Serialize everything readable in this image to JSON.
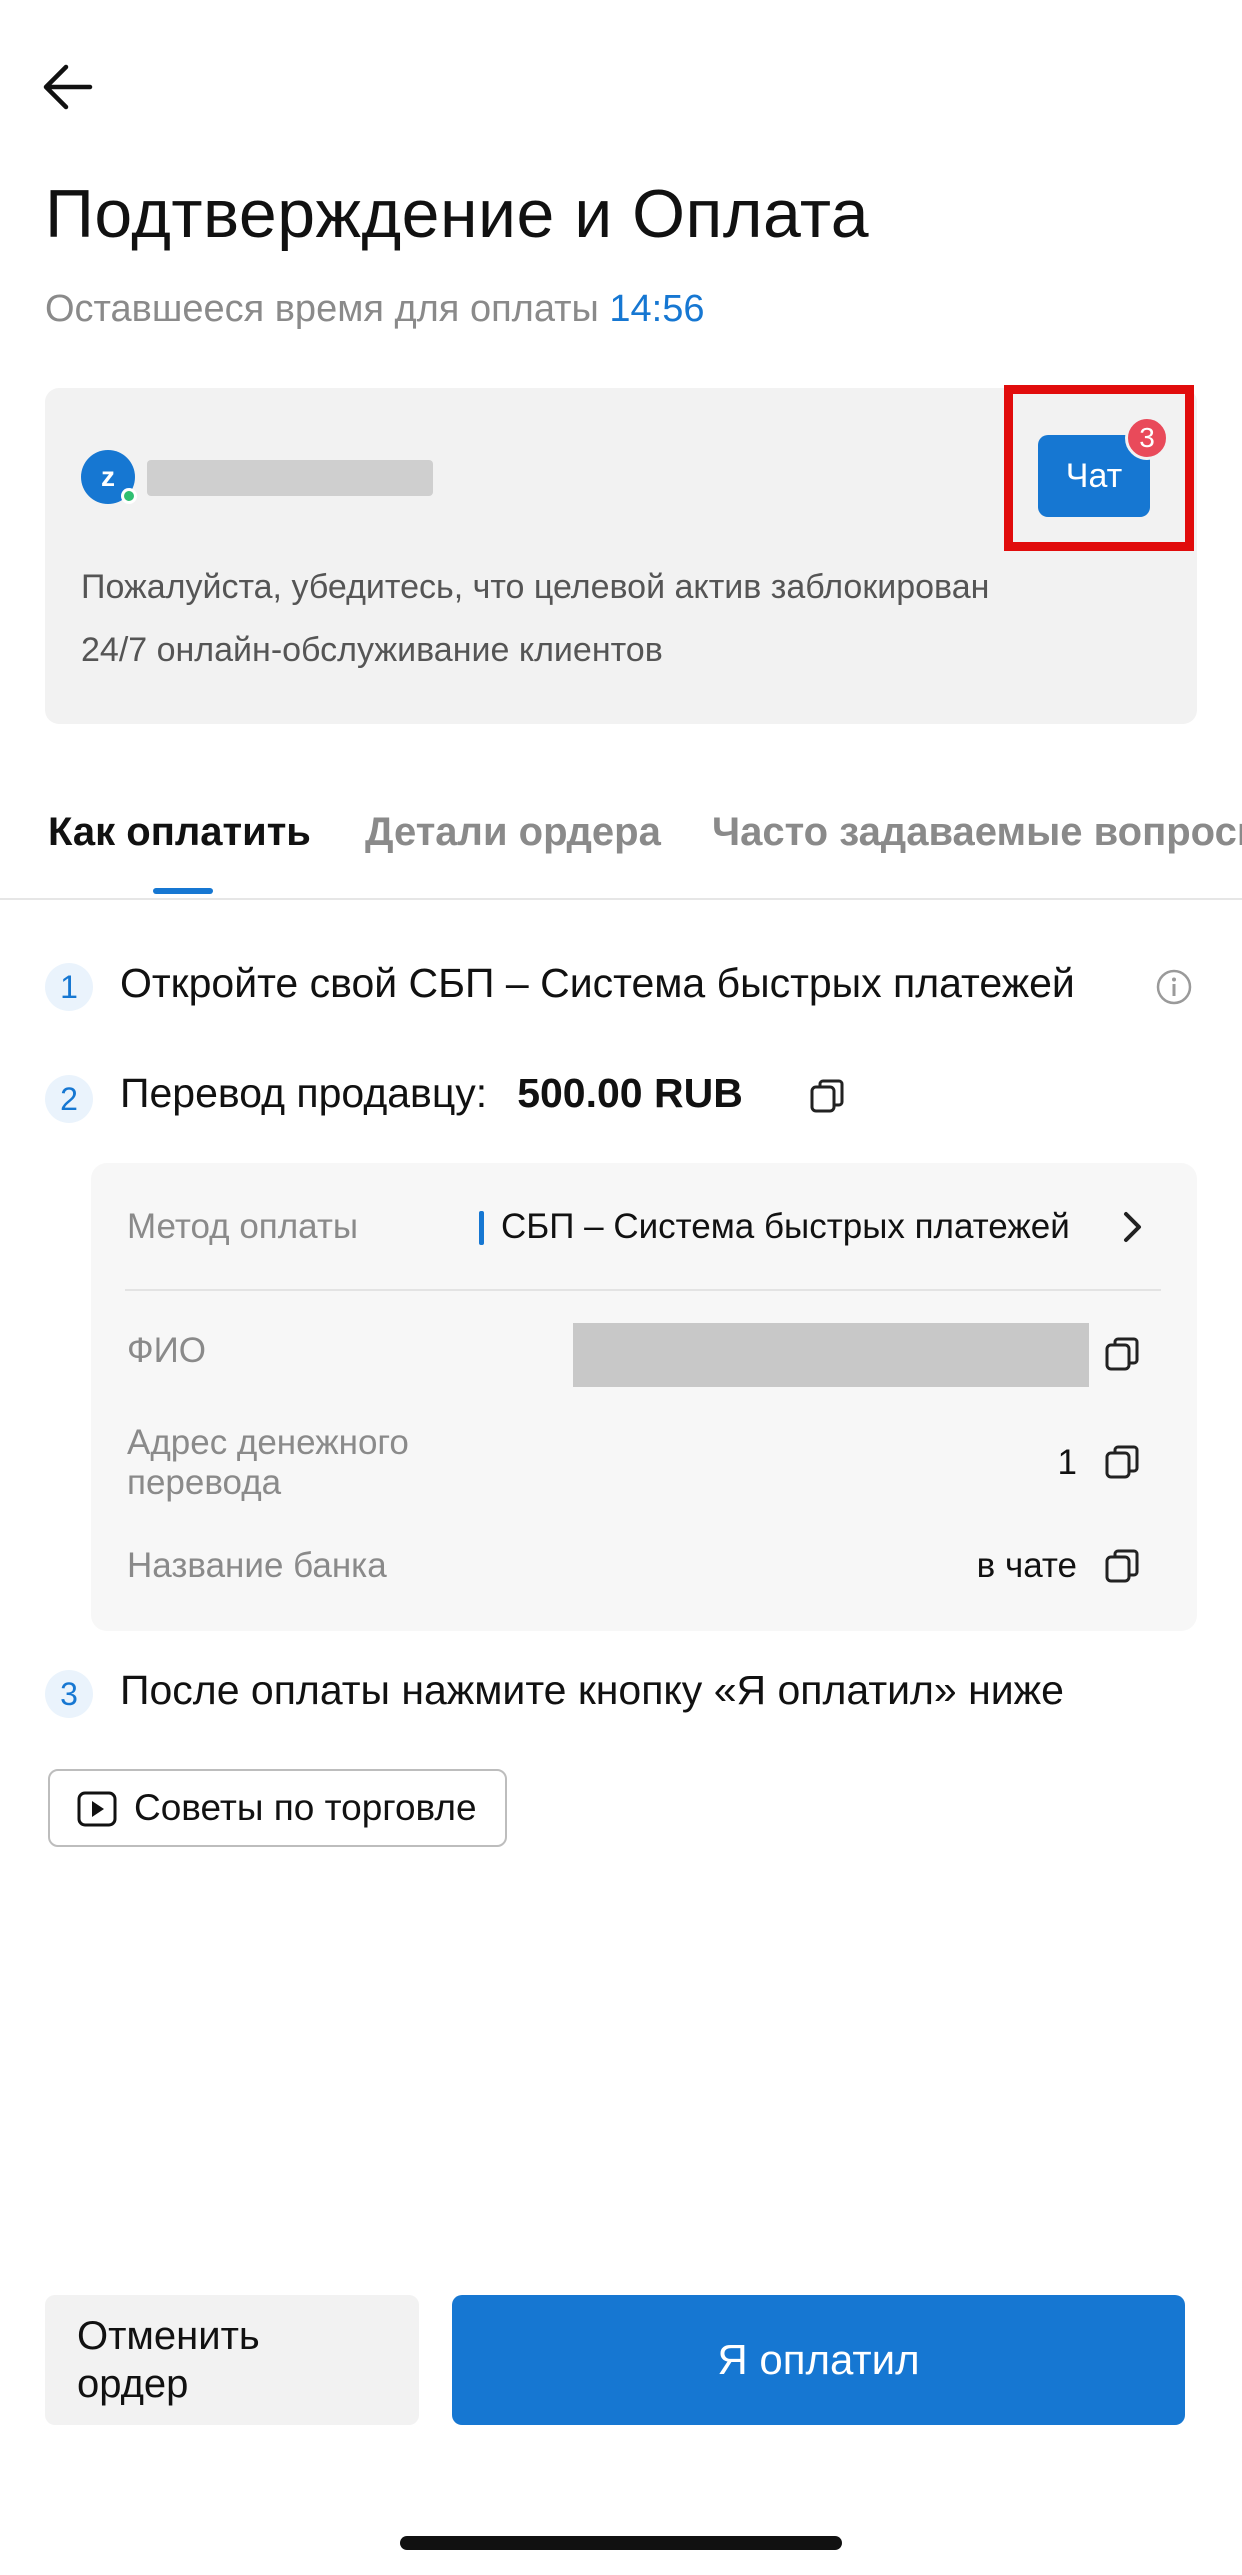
{
  "header": {
    "title": "Подтверждение и Оплата",
    "subtitle_prefix": "Оставшееся время для оплаты",
    "timer": "14:56"
  },
  "merchant": {
    "avatar_letter": "z",
    "chat_label": "Чат",
    "chat_badge": "3",
    "line1": "Пожалуйста, убедитесь, что целевой актив заблокирован",
    "line2": "24/7 онлайн-обслуживание клиентов"
  },
  "tabs": [
    {
      "label": "Как оплатить",
      "active": true
    },
    {
      "label": "Детали ордера",
      "active": false
    },
    {
      "label": "Часто задаваемые вопросы",
      "active": false
    }
  ],
  "steps": [
    {
      "num": "1",
      "text": "Откройте свой СБП – Система быстрых платежей"
    },
    {
      "num": "2",
      "text": "Перевод продавцу:",
      "amount": "500.00 RUB"
    },
    {
      "num": "3",
      "text": "После оплаты нажмите кнопку «Я оплатил» ниже"
    }
  ],
  "details": {
    "method_label": "Метод оплаты",
    "method_value": "СБП – Система быстрых платежей",
    "fio_label": "ФИО",
    "address_label": "Адрес денежного перевода",
    "address_value": "1",
    "bank_label": "Название банка",
    "bank_value": "в чате"
  },
  "tips_label": "Советы по торговле",
  "actions": {
    "cancel": "Отменить ордер",
    "paid": "Я оплатил"
  },
  "colors": {
    "accent": "#1677d2",
    "badge": "#e94a5a",
    "highlight": "#e10c0c"
  }
}
